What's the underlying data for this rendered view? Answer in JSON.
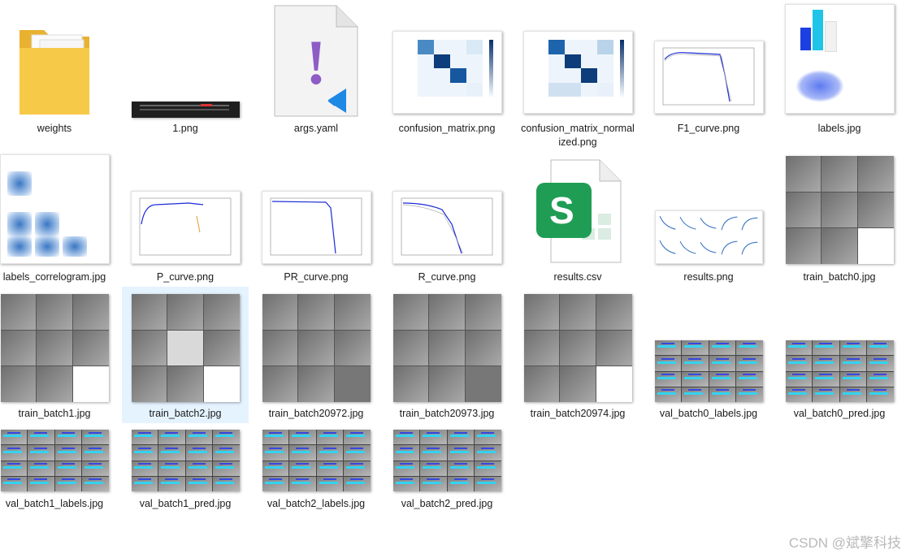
{
  "files": [
    {
      "id": "weights",
      "label": "weights",
      "icon": "folder-icon"
    },
    {
      "id": "1png",
      "label": "1.png",
      "icon": "image-thumbnail"
    },
    {
      "id": "args",
      "label": "args.yaml",
      "icon": "yaml-file-icon"
    },
    {
      "id": "cm",
      "label": "confusion_matrix.png",
      "icon": "image-thumbnail"
    },
    {
      "id": "cmn",
      "label": "confusion_matrix_normal\nized.png",
      "icon": "image-thumbnail"
    },
    {
      "id": "f1",
      "label": "F1_curve.png",
      "icon": "image-thumbnail"
    },
    {
      "id": "labels",
      "label": "labels.jpg",
      "icon": "image-thumbnail"
    },
    {
      "id": "labcor",
      "label": "labels_correlogram.jpg",
      "icon": "image-thumbnail"
    },
    {
      "id": "p",
      "label": "P_curve.png",
      "icon": "image-thumbnail"
    },
    {
      "id": "pr",
      "label": "PR_curve.png",
      "icon": "image-thumbnail"
    },
    {
      "id": "r",
      "label": "R_curve.png",
      "icon": "image-thumbnail"
    },
    {
      "id": "rcsv",
      "label": "results.csv",
      "icon": "spreadsheet-icon"
    },
    {
      "id": "rpng",
      "label": "results.png",
      "icon": "image-thumbnail"
    },
    {
      "id": "tb0",
      "label": "train_batch0.jpg",
      "icon": "image-thumbnail"
    },
    {
      "id": "tb1",
      "label": "train_batch1.jpg",
      "icon": "image-thumbnail"
    },
    {
      "id": "tb2",
      "label": "train_batch2.jpg",
      "icon": "image-thumbnail"
    },
    {
      "id": "tb20972",
      "label": "train_batch20972.jpg",
      "icon": "image-thumbnail"
    },
    {
      "id": "tb20973",
      "label": "train_batch20973.jpg",
      "icon": "image-thumbnail"
    },
    {
      "id": "tb20974",
      "label": "train_batch20974.jpg",
      "icon": "image-thumbnail"
    },
    {
      "id": "vb0l",
      "label": "val_batch0_labels.jpg",
      "icon": "image-thumbnail"
    },
    {
      "id": "vb0p",
      "label": "val_batch0_pred.jpg",
      "icon": "image-thumbnail"
    },
    {
      "id": "vb1l",
      "label": "val_batch1_labels.jpg",
      "icon": "image-thumbnail"
    },
    {
      "id": "vb1p",
      "label": "val_batch1_pred.jpg",
      "icon": "image-thumbnail"
    },
    {
      "id": "vb2l",
      "label": "val_batch2_labels.jpg",
      "icon": "image-thumbnail"
    },
    {
      "id": "vb2p",
      "label": "val_batch2_pred.jpg",
      "icon": "image-thumbnail"
    }
  ],
  "selected": "train_batch2.jpg",
  "watermark": "CSDN @斌擎科技",
  "colors": {
    "selection": "#cce8ff",
    "folder": "#f7c948",
    "csv": "#1f9d55",
    "yaml": "#8e5cc6",
    "vscode": "#1e88e5",
    "detect": "#33d3f0"
  }
}
